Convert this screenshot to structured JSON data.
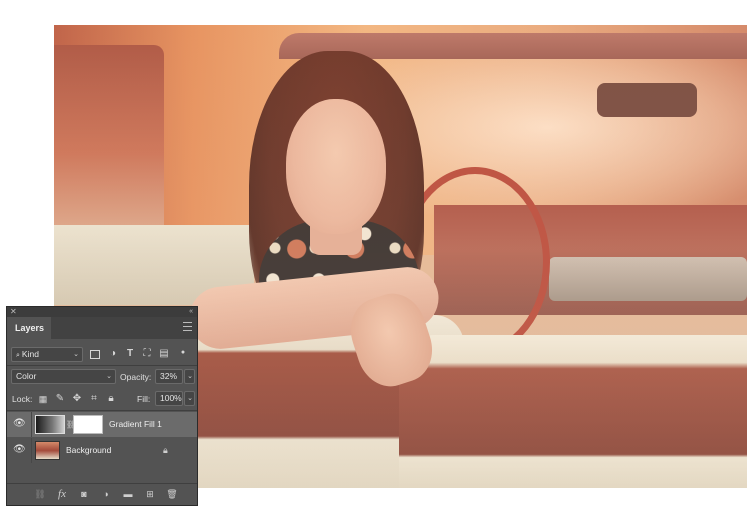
{
  "panel": {
    "close_glyph": "✕",
    "collapse_glyph": "«",
    "tab_label": "Layers",
    "filter": {
      "kind_label": "Kind",
      "search_glyph": "🔍"
    },
    "blend_mode": "Color",
    "opacity_label": "Opacity:",
    "opacity_value": "32%",
    "lock_label": "Lock:",
    "fill_label": "Fill:",
    "fill_value": "100%",
    "layers": [
      {
        "name": "Gradient Fill 1",
        "visible": true,
        "selected": true
      },
      {
        "name": "Background",
        "visible": true,
        "selected": false,
        "locked": true
      }
    ],
    "bottom_icons": [
      "link-icon",
      "fx-icon",
      "mask-icon",
      "adjustment-icon",
      "folder-icon",
      "new-layer-icon",
      "trash-icon"
    ],
    "fx_label": "fx"
  }
}
